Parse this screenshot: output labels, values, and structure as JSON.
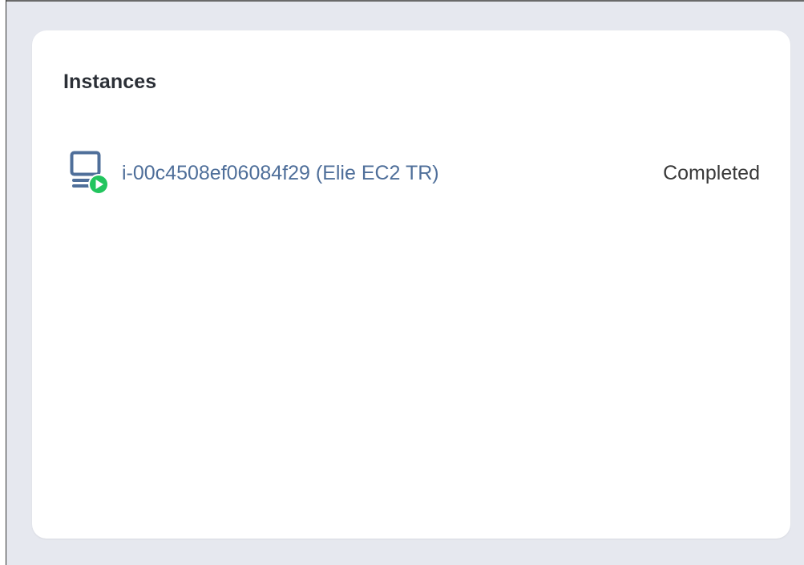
{
  "panel": {
    "title": "Instances"
  },
  "instances": [
    {
      "name": "i-00c4508ef06084f29 (Elie EC2 TR)",
      "status": "Completed",
      "icon": "instance-running-icon"
    }
  ],
  "colors": {
    "background": "#e6e8ef",
    "card": "#ffffff",
    "link": "#4f6f9a",
    "icon": "#4f6f9a",
    "status_badge": "#22c55e"
  }
}
